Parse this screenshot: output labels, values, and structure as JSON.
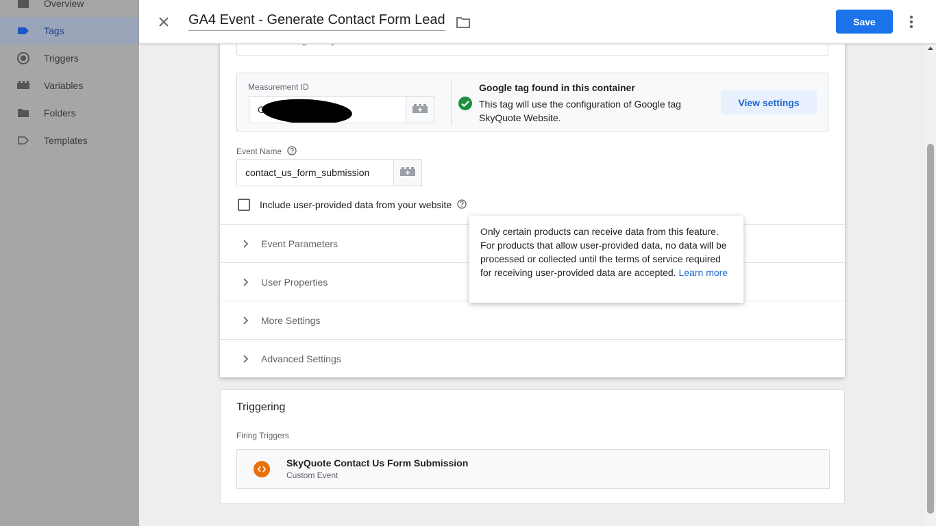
{
  "sidebar": {
    "items": [
      {
        "label": "Overview",
        "icon": "overview-icon"
      },
      {
        "label": "Tags",
        "icon": "tag-icon",
        "active": true
      },
      {
        "label": "Triggers",
        "icon": "trigger-icon"
      },
      {
        "label": "Variables",
        "icon": "variables-icon"
      },
      {
        "label": "Folders",
        "icon": "folder-icon"
      },
      {
        "label": "Templates",
        "icon": "template-icon"
      }
    ]
  },
  "header": {
    "title": "GA4 Event - Generate Contact Form Lead",
    "save_label": "Save"
  },
  "tag_config": {
    "tag_type_subtitle": "Google Analytics",
    "measurement_id_label": "Measurement ID",
    "measurement_id_value": "G-",
    "google_tag_found_title": "Google tag found in this container",
    "google_tag_found_desc": "This tag will use the configuration of Google tag SkyQuote Website.",
    "view_settings_label": "View settings",
    "event_name_label": "Event Name",
    "event_name_value": "contact_us_form_submission",
    "include_user_data_label": "Include user-provided data from your website",
    "include_user_data_checked": false,
    "sections": [
      "Event Parameters",
      "User Properties",
      "More Settings",
      "Advanced Settings"
    ]
  },
  "tooltip": {
    "text": "Only certain products can receive data from this feature. For products that allow user-provided data, no data will be processed or collected until the terms of service required for receiving user-provided data are accepted.",
    "link": "Learn more"
  },
  "triggering": {
    "title": "Triggering",
    "firing_label": "Firing Triggers",
    "trigger_name": "SkyQuote Contact Us Form Submission",
    "trigger_type": "Custom Event"
  },
  "colors": {
    "accent": "#1a73e8",
    "success": "#1e8e3e",
    "trigger_orange": "#e8710a"
  }
}
